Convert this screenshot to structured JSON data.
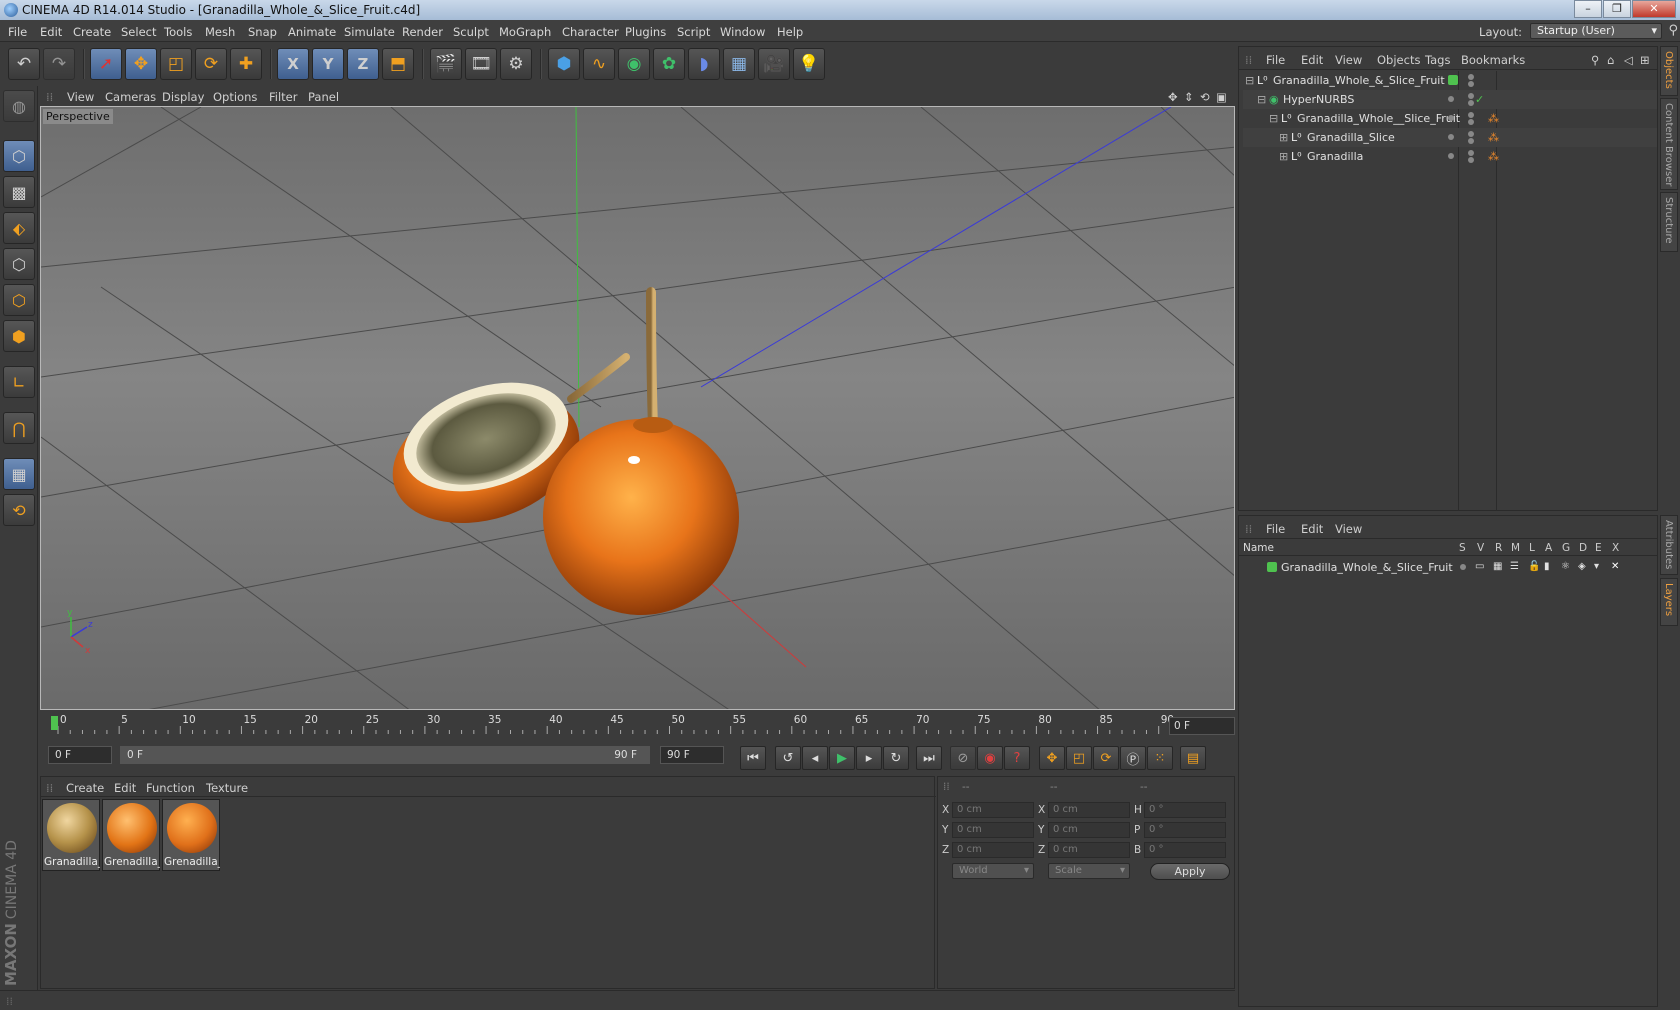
{
  "window": {
    "title": "CINEMA 4D R14.014 Studio - [Granadilla_Whole_&_Slice_Fruit.c4d]"
  },
  "menu": [
    "File",
    "Edit",
    "Create",
    "Select",
    "Tools",
    "Mesh",
    "Snap",
    "Animate",
    "Simulate",
    "Render",
    "Sculpt",
    "MoGraph",
    "Character",
    "Plugins",
    "Script",
    "Window",
    "Help"
  ],
  "layout": {
    "label": "Layout:",
    "value": "Startup (User)"
  },
  "toolbar_icons": [
    "undo-icon",
    "redo-icon",
    "live-select-icon",
    "move-icon",
    "scale-icon",
    "rotate-icon",
    "add-icon",
    "x-axis-icon",
    "y-axis-icon",
    "z-axis-icon",
    "coordinate-system-icon",
    "render-view-icon",
    "render-picture-viewer-icon",
    "render-settings-icon",
    "cube-icon",
    "spline-icon",
    "nurbs-icon",
    "array-icon",
    "deformer-icon",
    "floor-icon",
    "camera-icon",
    "light-icon"
  ],
  "toolbar_glyphs": {
    "x": "X",
    "y": "Y",
    "z": "Z"
  },
  "viewport": {
    "menu": [
      "View",
      "Cameras",
      "Display",
      "Options",
      "Filter",
      "Panel"
    ],
    "label": "Perspective"
  },
  "timeline": {
    "ticks": [
      "0",
      "5",
      "10",
      "15",
      "20",
      "25",
      "30",
      "35",
      "40",
      "45",
      "50",
      "55",
      "60",
      "65",
      "70",
      "75",
      "80",
      "85",
      "90"
    ],
    "current": "0 F"
  },
  "transport": {
    "start": "0 F",
    "range_start": "0 F",
    "range_end": "90 F",
    "end": "90 F"
  },
  "materials": {
    "menu": [
      "Create",
      "Edit",
      "Function",
      "Texture"
    ],
    "items": [
      {
        "name": "Granadilla_",
        "color": "#b5924a"
      },
      {
        "name": "Grenadilla_",
        "color": "#e27416"
      },
      {
        "name": "Grenadilla_",
        "color": "#e0701a"
      }
    ]
  },
  "coordinates": {
    "headers": [
      "--",
      "--",
      "--"
    ],
    "rows": [
      {
        "a": "X",
        "av": "0 cm",
        "b": "X",
        "bv": "0 cm",
        "c": "H",
        "cv": "0 °"
      },
      {
        "a": "Y",
        "av": "0 cm",
        "b": "Y",
        "bv": "0 cm",
        "c": "P",
        "cv": "0 °"
      },
      {
        "a": "Z",
        "av": "0 cm",
        "b": "Z",
        "bv": "0 cm",
        "c": "B",
        "cv": "0 °"
      }
    ],
    "space": "World",
    "mode": "Scale",
    "apply": "Apply"
  },
  "objects": {
    "menu": [
      "File",
      "Edit",
      "View",
      "Objects",
      "Tags",
      "Bookmarks"
    ],
    "rows": [
      {
        "name": "Granadilla_Whole_&_Slice_Fruit",
        "indent": 0
      },
      {
        "name": "HyperNURBS",
        "indent": 1
      },
      {
        "name": "Granadilla_Whole__Slice_Fruit",
        "indent": 2
      },
      {
        "name": "Granadilla_Slice",
        "indent": 3
      },
      {
        "name": "Granadilla",
        "indent": 3
      }
    ]
  },
  "layers": {
    "menu": [
      "File",
      "Edit",
      "View"
    ],
    "headers": [
      "Name",
      "S",
      "V",
      "R",
      "M",
      "L",
      "A",
      "G",
      "D",
      "E",
      "X"
    ],
    "rows": [
      {
        "name": "Granadilla_Whole_&_Slice_Fruit",
        "color": "#4fc24f"
      }
    ]
  },
  "side_tabs": [
    "Objects",
    "Content Browser",
    "Structure",
    "Attributes",
    "Layers"
  ],
  "brand": {
    "maxon": "MAXON",
    "product": "CINEMA 4D"
  }
}
